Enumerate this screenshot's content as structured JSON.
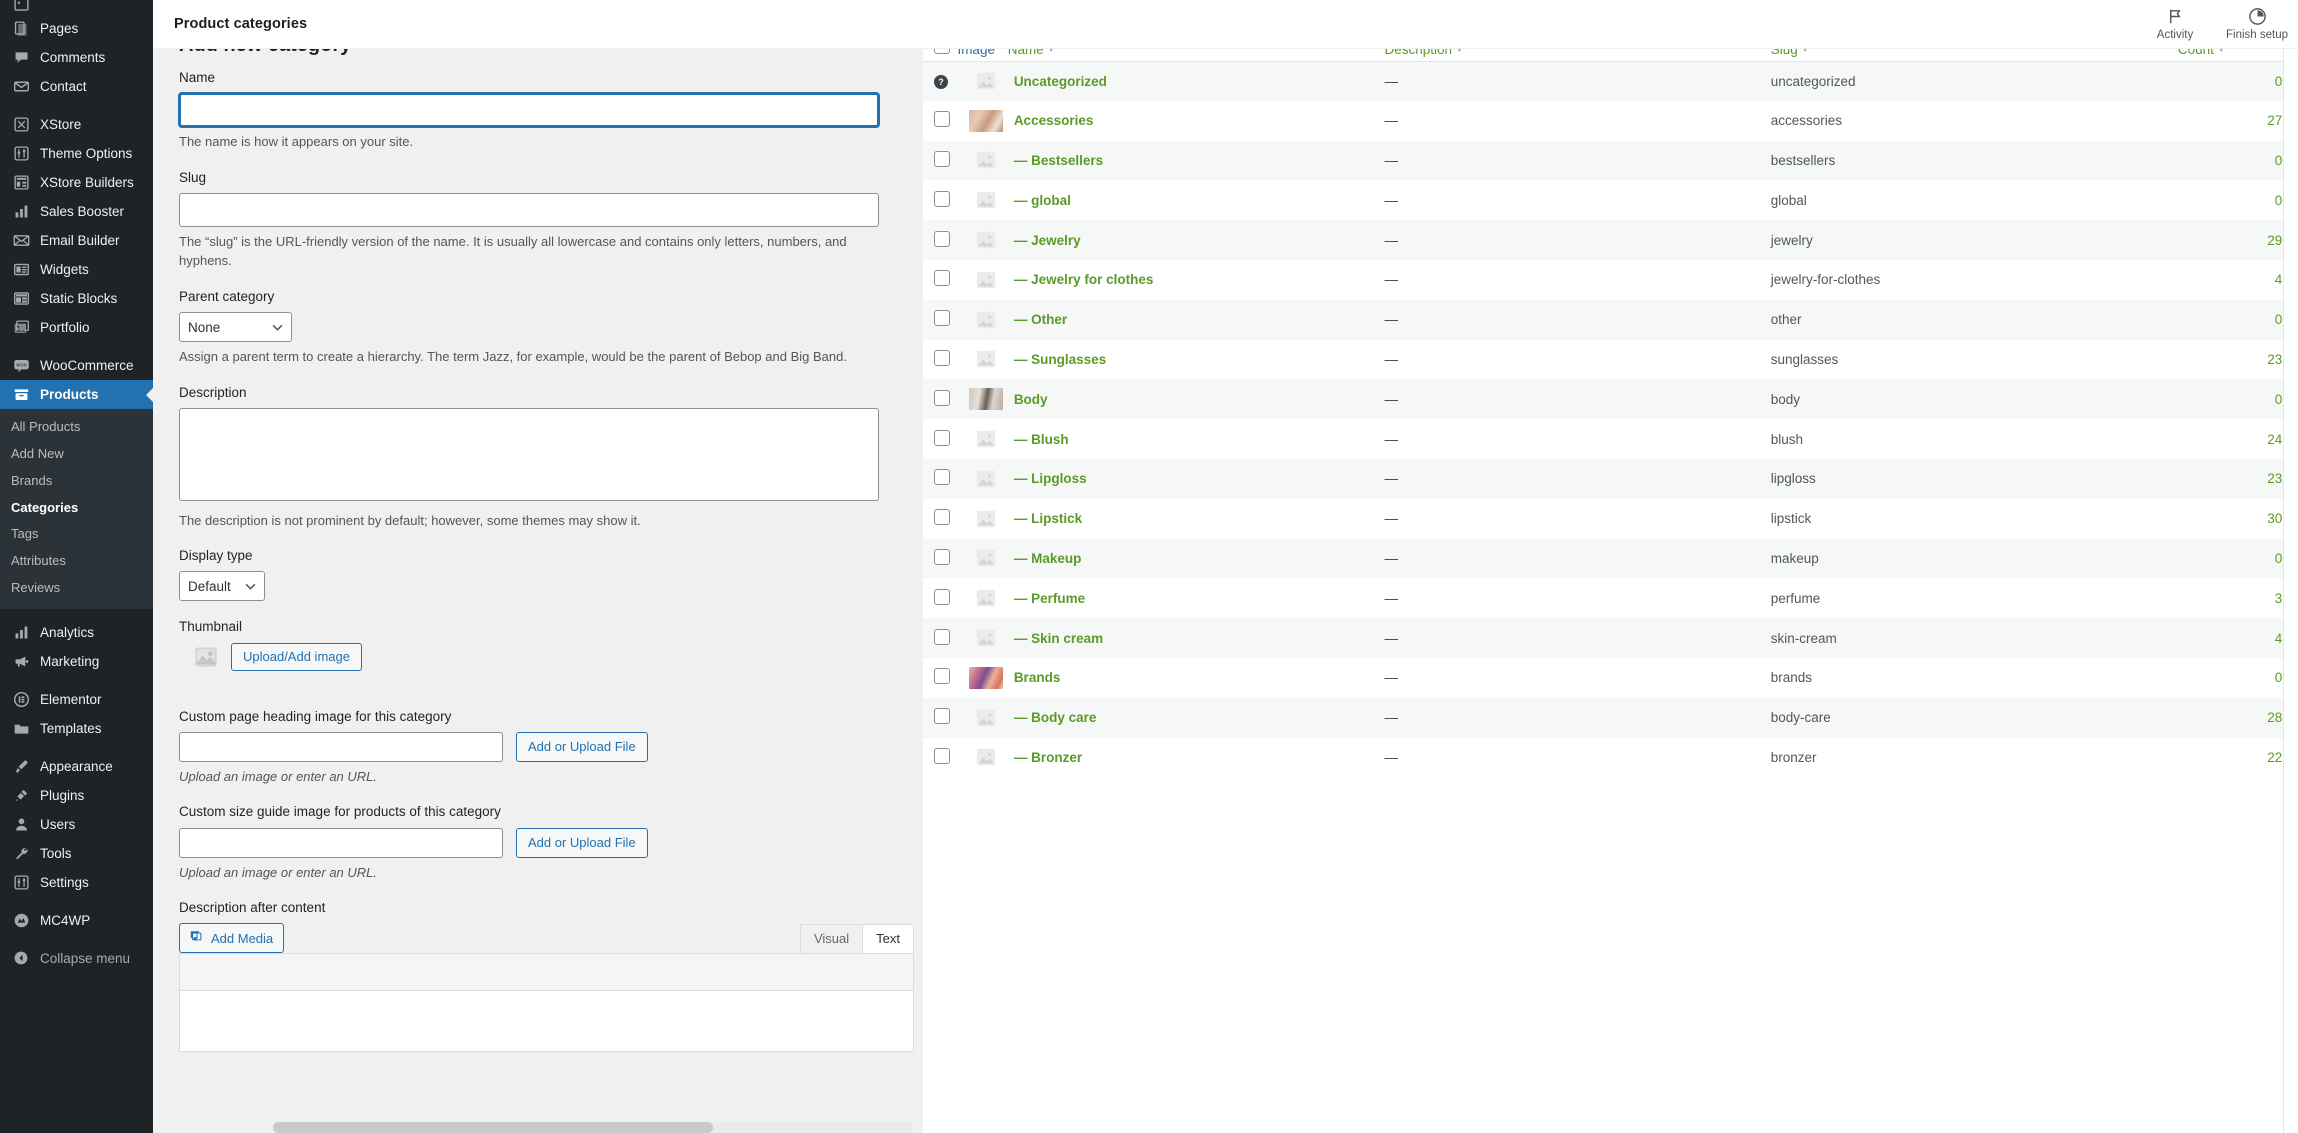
{
  "sidebar": {
    "items": [
      {
        "label": "",
        "icon": "media-icon",
        "partial": true
      },
      {
        "label": "Pages",
        "icon": "pages-icon"
      },
      {
        "label": "Comments",
        "icon": "comments-icon"
      },
      {
        "label": "Contact",
        "icon": "envelope-icon"
      },
      {
        "label": "XStore",
        "icon": "xstore-icon"
      },
      {
        "label": "Theme Options",
        "icon": "sliders-icon"
      },
      {
        "label": "XStore Builders",
        "icon": "builders-icon"
      },
      {
        "label": "Sales Booster",
        "icon": "bars-icon"
      },
      {
        "label": "Email Builder",
        "icon": "mail-icon"
      },
      {
        "label": "Widgets",
        "icon": "widgets-icon"
      },
      {
        "label": "Static Blocks",
        "icon": "blocks-icon"
      },
      {
        "label": "Portfolio",
        "icon": "portfolio-icon"
      },
      {
        "label": "WooCommerce",
        "icon": "woo-icon"
      }
    ],
    "current_item": {
      "label": "Products",
      "icon": "products-icon"
    },
    "submenu": [
      {
        "label": "All Products",
        "current": false
      },
      {
        "label": "Add New",
        "current": false
      },
      {
        "label": "Brands",
        "current": false
      },
      {
        "label": "Categories",
        "current": true
      },
      {
        "label": "Tags",
        "current": false
      },
      {
        "label": "Attributes",
        "current": false
      },
      {
        "label": "Reviews",
        "current": false
      }
    ],
    "items_after": [
      {
        "label": "Analytics",
        "icon": "analytics-icon"
      },
      {
        "label": "Marketing",
        "icon": "megaphone-icon"
      },
      {
        "label": "Elementor",
        "icon": "elementor-icon"
      },
      {
        "label": "Templates",
        "icon": "folder-icon"
      },
      {
        "label": "Appearance",
        "icon": "brush-icon"
      },
      {
        "label": "Plugins",
        "icon": "plug-icon"
      },
      {
        "label": "Users",
        "icon": "user-icon"
      },
      {
        "label": "Tools",
        "icon": "wrench-icon"
      },
      {
        "label": "Settings",
        "icon": "settings-icon"
      },
      {
        "label": "MC4WP",
        "icon": "mc4wp-icon"
      }
    ],
    "collapse_label": "Collapse menu"
  },
  "header": {
    "title": "Product categories",
    "actions": [
      {
        "label": "Activity",
        "icon": "flag-icon"
      },
      {
        "label": "Finish setup",
        "icon": "progress-circle-icon"
      }
    ]
  },
  "form": {
    "heading": "Add new category",
    "name": {
      "label": "Name",
      "value": "",
      "help": "The name is how it appears on your site."
    },
    "slug": {
      "label": "Slug",
      "value": "",
      "help": "The “slug” is the URL-friendly version of the name. It is usually all lowercase and contains only letters, numbers, and hyphens."
    },
    "parent": {
      "label": "Parent category",
      "value": "None",
      "options": [
        "None"
      ],
      "help": "Assign a parent term to create a hierarchy. The term Jazz, for example, would be the parent of Bebop and Big Band."
    },
    "description": {
      "label": "Description",
      "value": "",
      "help": "The description is not prominent by default; however, some themes may show it."
    },
    "display_type": {
      "label": "Display type",
      "value": "Default",
      "options": [
        "Default"
      ]
    },
    "thumbnail": {
      "label": "Thumbnail",
      "button": "Upload/Add image"
    },
    "page_heading_image": {
      "label": "Custom page heading image for this category",
      "value": "",
      "button": "Add or Upload File",
      "help": "Upload an image or enter an URL."
    },
    "size_guide_image": {
      "label": "Custom size guide image for products of this category",
      "value": "",
      "button": "Add or Upload File",
      "help": "Upload an image or enter an URL."
    },
    "description_after_content": {
      "label": "Description after content",
      "add_media_button": "Add Media",
      "tabs": [
        {
          "label": "Visual",
          "active": true
        },
        {
          "label": "Text",
          "active": false
        }
      ]
    }
  },
  "table": {
    "columns": [
      {
        "label": "Image",
        "sortable": false,
        "style": "dark"
      },
      {
        "label": "Name",
        "sortable": true,
        "style": "green"
      },
      {
        "label": "Description",
        "sortable": true,
        "style": "green"
      },
      {
        "label": "Slug",
        "sortable": true,
        "style": "green"
      },
      {
        "label": "Count",
        "sortable": true,
        "style": "green"
      }
    ],
    "rows": [
      {
        "name": "Uncategorized",
        "prefix": "",
        "description": "—",
        "slug": "uncategorized",
        "count": "0",
        "thumb": "placeholder",
        "checkbox": false,
        "help": true
      },
      {
        "name": "Accessories",
        "prefix": "",
        "description": "—",
        "slug": "accessories",
        "count": "27",
        "thumb": "img-accessories",
        "checkbox": true,
        "help": false
      },
      {
        "name": "Bestsellers",
        "prefix": "— ",
        "description": "—",
        "slug": "bestsellers",
        "count": "0",
        "thumb": "placeholder",
        "checkbox": true,
        "help": false
      },
      {
        "name": "global",
        "prefix": "— ",
        "description": "—",
        "slug": "global",
        "count": "0",
        "thumb": "placeholder",
        "checkbox": true,
        "help": false
      },
      {
        "name": "Jewelry",
        "prefix": "— ",
        "description": "—",
        "slug": "jewelry",
        "count": "29",
        "thumb": "placeholder",
        "checkbox": true,
        "help": false
      },
      {
        "name": "Jewelry for clothes",
        "prefix": "— ",
        "description": "—",
        "slug": "jewelry-for-clothes",
        "count": "4",
        "thumb": "placeholder",
        "checkbox": true,
        "help": false
      },
      {
        "name": "Other",
        "prefix": "— ",
        "description": "—",
        "slug": "other",
        "count": "0",
        "thumb": "placeholder",
        "checkbox": true,
        "help": false
      },
      {
        "name": "Sunglasses",
        "prefix": "— ",
        "description": "—",
        "slug": "sunglasses",
        "count": "23",
        "thumb": "placeholder",
        "checkbox": true,
        "help": false
      },
      {
        "name": "Body",
        "prefix": "",
        "description": "—",
        "slug": "body",
        "count": "0",
        "thumb": "img-body",
        "checkbox": true,
        "help": false
      },
      {
        "name": "Blush",
        "prefix": "— ",
        "description": "—",
        "slug": "blush",
        "count": "24",
        "thumb": "placeholder",
        "checkbox": true,
        "help": false
      },
      {
        "name": "Lipgloss",
        "prefix": "— ",
        "description": "—",
        "slug": "lipgloss",
        "count": "23",
        "thumb": "placeholder",
        "checkbox": true,
        "help": false
      },
      {
        "name": "Lipstick",
        "prefix": "— ",
        "description": "—",
        "slug": "lipstick",
        "count": "30",
        "thumb": "placeholder",
        "checkbox": true,
        "help": false
      },
      {
        "name": "Makeup",
        "prefix": "— ",
        "description": "—",
        "slug": "makeup",
        "count": "0",
        "thumb": "placeholder",
        "checkbox": true,
        "help": false
      },
      {
        "name": "Perfume",
        "prefix": "— ",
        "description": "—",
        "slug": "perfume",
        "count": "3",
        "thumb": "placeholder",
        "checkbox": true,
        "help": false
      },
      {
        "name": "Skin cream",
        "prefix": "— ",
        "description": "—",
        "slug": "skin-cream",
        "count": "4",
        "thumb": "placeholder",
        "checkbox": true,
        "help": false
      },
      {
        "name": "Brands",
        "prefix": "",
        "description": "—",
        "slug": "brands",
        "count": "0",
        "thumb": "img-brands",
        "checkbox": true,
        "help": false
      },
      {
        "name": "Body care",
        "prefix": "— ",
        "description": "—",
        "slug": "body-care",
        "count": "28",
        "thumb": "placeholder",
        "checkbox": true,
        "help": false
      },
      {
        "name": "Bronzer",
        "prefix": "— ",
        "description": "—",
        "slug": "bronzer",
        "count": "22",
        "thumb": "placeholder",
        "checkbox": true,
        "help": false
      }
    ]
  },
  "colors": {
    "sidebar_bg": "#1d2327",
    "sidebar_active": "#2271b1",
    "link_green": "#5a9b27",
    "accent_blue": "#2271b1"
  }
}
